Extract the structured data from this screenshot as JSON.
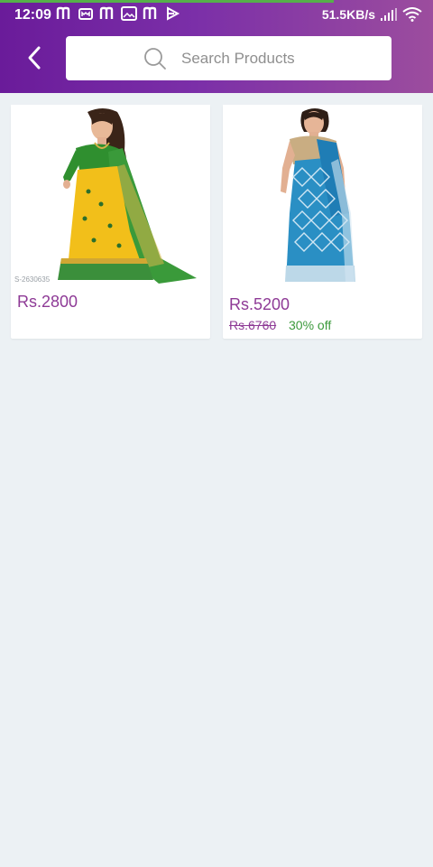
{
  "status_bar": {
    "time": "12:09",
    "network_speed": "51.5KB/s",
    "icons": [
      "notification-m-icon",
      "notification-app-icon",
      "notification-m-icon",
      "notification-image-icon",
      "notification-m-icon",
      "notification-play-icon",
      "signal-icon",
      "wifi-icon"
    ]
  },
  "header": {
    "back_icon": "chevron-left-icon",
    "search": {
      "placeholder": "Search Products",
      "value": ""
    }
  },
  "products": [
    {
      "image": "saree-yellow-green",
      "sku_text": "S-2630635",
      "price": "Rs.2800"
    },
    {
      "image": "saree-blue",
      "price": "Rs.5200",
      "old_price": "Rs.6760",
      "discount": "30% off"
    }
  ],
  "colors": {
    "header_start": "#6a1b9a",
    "header_end": "#9c4d9e",
    "price": "#8e3a96",
    "discount": "#3c9a3c",
    "background": "#ecf1f4"
  }
}
